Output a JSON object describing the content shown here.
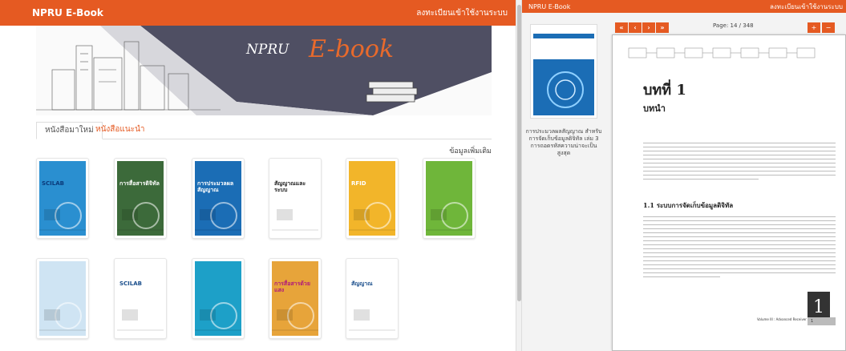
{
  "left": {
    "brand": "NPRU E-Book",
    "login": "ลงทะเบียนเข้าใช้งานระบบ",
    "banner_a": "NPRU",
    "banner_b": "E-book",
    "tabs": [
      "หนังสือมาใหม่",
      "หนังสือแนะนำ"
    ],
    "more": "ข้อมูลเพิ่มเติม",
    "books": [
      {
        "title": "SCILAB",
        "bg": "#2a8fd0",
        "fg": "#0a3a7a"
      },
      {
        "title": "การสื่อสารดิจิทัล",
        "bg": "#3c6a3a",
        "fg": "#ffffff"
      },
      {
        "title": "การประมวลผลสัญญาณ",
        "bg": "#1b6db5",
        "fg": "#ffffff"
      },
      {
        "title": "สัญญาณและระบบ",
        "bg": "#ffffff",
        "fg": "#222222"
      },
      {
        "title": "RFID",
        "bg": "#f2b52a",
        "fg": "#ffffff"
      },
      {
        "title": "",
        "bg": "#6fb63a",
        "fg": "#ffffff"
      },
      {
        "title": "",
        "bg": "#cfe4f3",
        "fg": "#1b4f8c"
      },
      {
        "title": "SCILAB",
        "bg": "#ffffff",
        "fg": "#1b4f8c"
      },
      {
        "title": "",
        "bg": "#1da0c8",
        "fg": "#ffffff"
      },
      {
        "title": "การสื่อสารด้วยแสง",
        "bg": "#e7a43a",
        "fg": "#b01a7a"
      },
      {
        "title": "สัญญาณ",
        "bg": "#ffffff",
        "fg": "#1b4f8c"
      }
    ]
  },
  "right": {
    "brand": "NPRU E-Book",
    "login": "ลงทะเบียนเข้าใช้งานระบบ",
    "caption": "การประมวลผลสัญญาณ สำหรับการจัดเก็บข้อมูลดิจิทัล เล่ม 3 การถอดรหัสความน่าจะเป็นสูงสุด",
    "controls": [
      "«",
      "‹",
      "›",
      "»"
    ],
    "page_label": "Page: 14 / 348",
    "chapter": "บทที่ 1",
    "chapter_sub": "บทนำ",
    "section": "1.1 ระบบการจัดเก็บข้อมูลดิจิทัล",
    "page_num": "1",
    "footer": "Volume III : Advanced Receiver Design",
    "footer_page": "1"
  }
}
